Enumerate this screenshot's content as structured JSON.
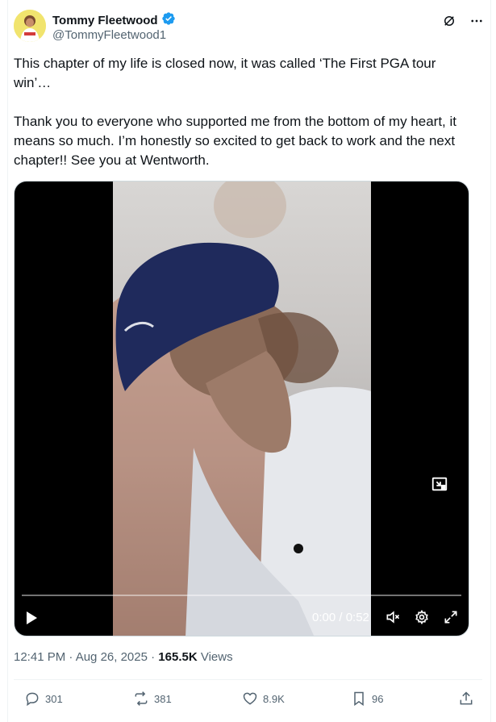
{
  "author": {
    "display_name": "Tommy Fleetwood",
    "handle": "@TommyFleetwood1",
    "verified": true
  },
  "header_icons": [
    "grok-icon",
    "more-icon"
  ],
  "tweet": {
    "text": "This chapter of my life is closed now, it was called ‘The First PGA tour win’…\n\nThank you to everyone who supported me from the bottom of my heart, it means so much. I’m honestly so excited to get back to work and the next chapter!! See you at Wentworth."
  },
  "video": {
    "time": "0:00 / 0:52",
    "progress": 0
  },
  "meta": {
    "timestamp": "12:41 PM · Aug 26, 2025",
    "separator": " · ",
    "views_count": "165.5K",
    "views_label": " Views"
  },
  "actions": {
    "replies": "301",
    "reposts": "381",
    "likes": "8.9K",
    "bookmarks": "96"
  },
  "colors": {
    "verified": "#1d9bf0",
    "secondary": "#536471",
    "text": "#0f1419"
  }
}
